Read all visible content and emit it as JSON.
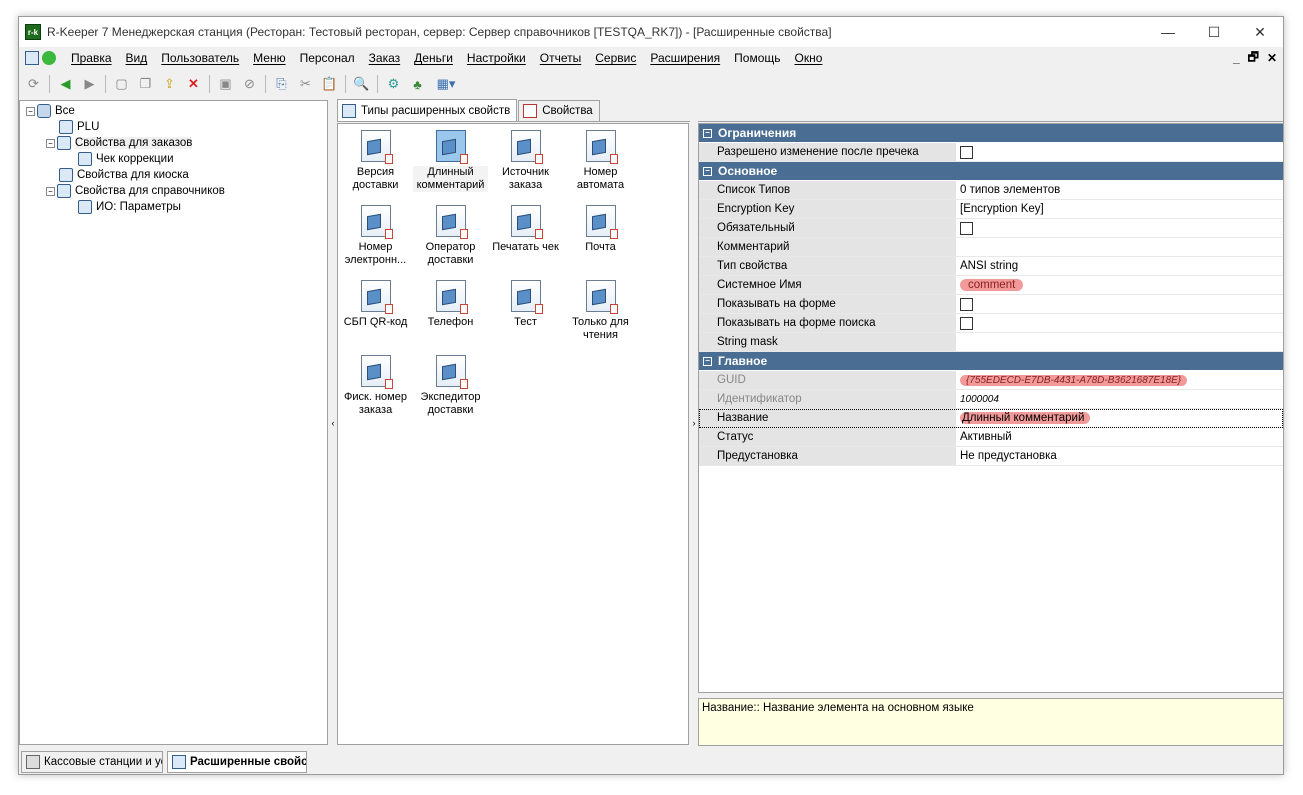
{
  "window": {
    "app_icon": "r-k",
    "title": "R-Keeper 7 Менеджерская станция (Ресторан: Тестовый ресторан, сервер: Сервер справочников [TESTQA_RK7]) - [Расширенные свойства]",
    "minimize": "—",
    "maximize": "☐",
    "close": "✕"
  },
  "menu": {
    "items": [
      "Правка",
      "Вид",
      "Пользователь",
      "Меню",
      "Персонал",
      "Заказ",
      "Деньги",
      "Настройки",
      "Отчеты",
      "Сервис",
      "Расширения",
      "Помощь",
      "Окно"
    ],
    "right": [
      "_",
      "🗗",
      "✕"
    ]
  },
  "toolbar": {
    "icons": [
      "refresh-icon",
      "back-icon",
      "forward-icon",
      "new-icon",
      "copy-icon",
      "export-icon",
      "delete-icon",
      "save-icon",
      "cancel-icon",
      "copy-doc-icon",
      "cut-icon",
      "paste-icon",
      "find-icon",
      "tool-icon",
      "link-icon",
      "grid-icon"
    ]
  },
  "tree": {
    "root": "Все",
    "items": [
      {
        "label": "PLU"
      },
      {
        "label": "Свойства для заказов"
      },
      {
        "label": "Чек коррекции"
      },
      {
        "label": "Свойства для киоска"
      },
      {
        "label": "Свойства для справочников"
      },
      {
        "label": "ИО: Параметры"
      }
    ]
  },
  "tabs": [
    {
      "label": "Типы расширенных свойств"
    },
    {
      "label": "Свойства"
    }
  ],
  "items": [
    {
      "l1": "Версия",
      "l2": "доставки"
    },
    {
      "l1": "Длинный",
      "l2": "комментарий"
    },
    {
      "l1": "Источник",
      "l2": "заказа"
    },
    {
      "l1": "Номер",
      "l2": "автомата"
    },
    {
      "l1": "Номер",
      "l2": "электронн..."
    },
    {
      "l1": "Оператор",
      "l2": "доставки"
    },
    {
      "l1": "Печатать чек",
      "l2": ""
    },
    {
      "l1": "Почта",
      "l2": ""
    },
    {
      "l1": "СБП QR-код",
      "l2": ""
    },
    {
      "l1": "Телефон",
      "l2": ""
    },
    {
      "l1": "Тест",
      "l2": ""
    },
    {
      "l1": "Только для",
      "l2": "чтения"
    },
    {
      "l1": "Фиск. номер",
      "l2": "заказа"
    },
    {
      "l1": "Экспедитор",
      "l2": "доставки"
    }
  ],
  "props": {
    "groups": [
      {
        "title": "Ограничения",
        "rows": [
          {
            "name": "Разрешено изменение после пречека",
            "value": "",
            "type": "check"
          }
        ]
      },
      {
        "title": "Основное",
        "rows": [
          {
            "name": "Список Типов",
            "value": "0 типов элементов",
            "type": "text"
          },
          {
            "name": "Encryption Key",
            "value": "[Encryption Key]",
            "type": "text"
          },
          {
            "name": "Обязательный",
            "value": "",
            "type": "check"
          },
          {
            "name": "Комментарий",
            "value": "",
            "type": "text"
          },
          {
            "name": "Тип свойства",
            "value": "ANSI string",
            "type": "text"
          },
          {
            "name": "Системное Имя",
            "value": "comment",
            "type": "hl"
          },
          {
            "name": "Показывать на форме",
            "value": "",
            "type": "check"
          },
          {
            "name": "Показывать на форме поиска",
            "value": "",
            "type": "check"
          },
          {
            "name": "String mask",
            "value": "",
            "type": "text"
          }
        ]
      },
      {
        "title": "Главное",
        "rows": [
          {
            "name": "GUID",
            "value": "{755EDECD-E7DB-4431-A78D-B3621687E18E}",
            "type": "hl2",
            "dis": true
          },
          {
            "name": "Идентификатор",
            "value": "1000004",
            "type": "ital",
            "dis": true
          },
          {
            "name": "Название",
            "value": "Длинный комментарий",
            "type": "hl"
          },
          {
            "name": "Статус",
            "value": "Активный",
            "type": "text"
          },
          {
            "name": "Предустановка",
            "value": "Не предустановка",
            "type": "text"
          }
        ]
      }
    ]
  },
  "description": "Название:: Название элемента на основном языке",
  "taskbar": [
    {
      "label": "Кассовые станции и ус"
    },
    {
      "label": "Расширенные свойс"
    }
  ]
}
